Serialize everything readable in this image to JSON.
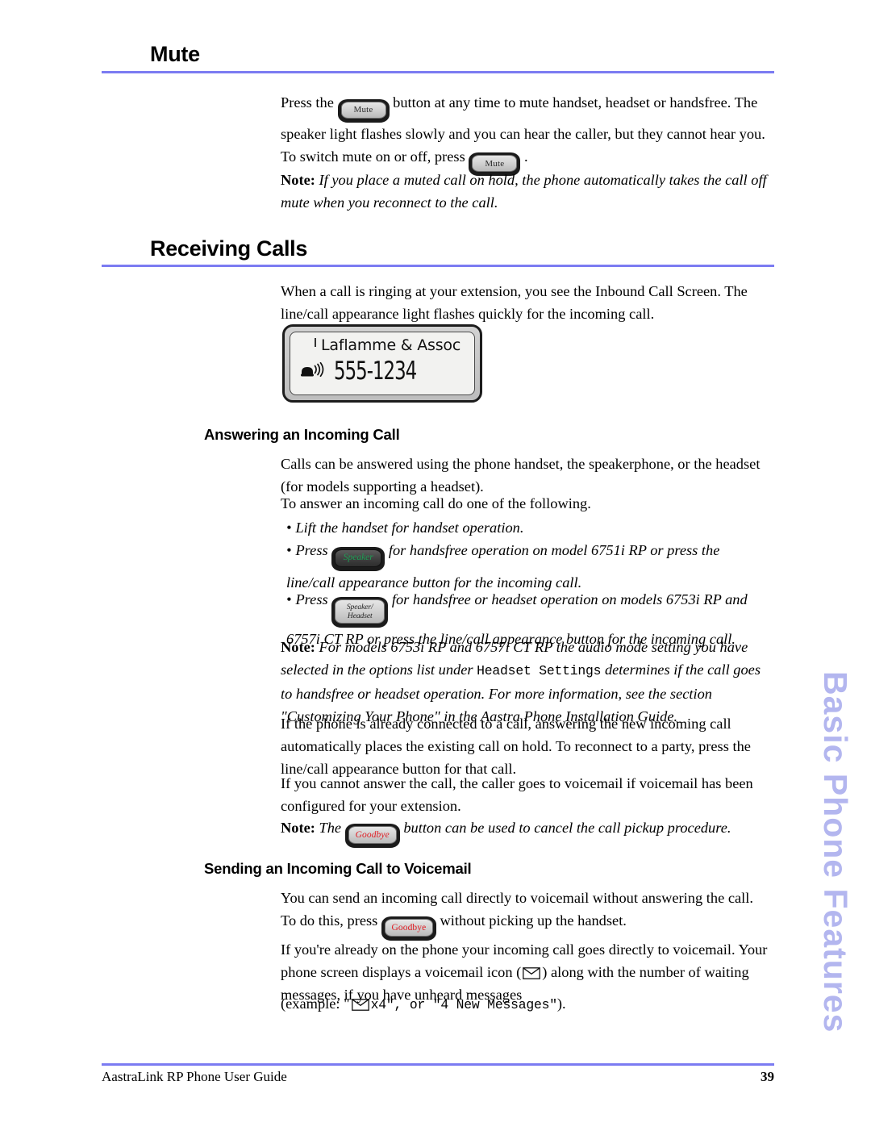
{
  "document": {
    "footer_title": "AastraLink RP Phone User Guide",
    "page_number": "39",
    "side_tab": "Basic Phone Features",
    "rule_color": "#7b7bf2",
    "side_tab_color": "#b3b6ef"
  },
  "sections": {
    "mute": {
      "heading": "Mute",
      "p1_a": "Press the",
      "p1_b": "button at any time to mute handset, headset or handsfree. The speaker light flashes slowly and you can hear the caller, but they cannot hear you. To switch mute on or off, press",
      "p1_c": ".",
      "note_label": "Note:",
      "note_text": "If you place a muted call on hold, the phone automatically takes the call off mute when you reconnect to the call."
    },
    "receiving_calls": {
      "heading": "Receiving Calls",
      "p1": "When a call is ringing at your extension, you see the Inbound Call Screen. The line/call appearance light flashes quickly for the incoming call.",
      "lcd_screen": {
        "caller_name": "Laflamme & Assoc",
        "caller_number": "555-1234",
        "ring_icon": "ringing-phone-icon"
      }
    },
    "answering": {
      "heading": "Answering an Incoming Call",
      "p1": "Calls can be answered using the phone handset, the speakerphone, or the headset (for models supporting a headset).",
      "p2": "To answer an incoming call do one of the following.",
      "bullets": [
        {
          "text_before": "Lift the handset for handset operation.",
          "button": null,
          "text_after": ""
        },
        {
          "text_before": "Press",
          "button": "Speaker",
          "text_after": "for handsfree operation on model 6751i RP or press the line/call appearance button for the incoming call."
        },
        {
          "text_before": "Press",
          "button": "Speaker/ Headset",
          "text_after": "for handsfree or headset operation on models 6753i RP and 6757i CT RP or press the line/call appearance button for the incoming call."
        }
      ],
      "note_label": "Note:",
      "note_a": "For models 6753i RP and 6757i CT RP the audio mode setting you have selected in the options list under",
      "note_mono": "Headset Settings",
      "note_b": "determines if the call goes to handsfree or headset operation. For more information, see the section \"Customizing Your Phone\" in the Aastra Phone Installation Guide.",
      "p3": "If the phone is already connected to a call, answering the new incoming call automatically places the existing call on hold. To reconnect to a party, press the line/call appearance button for that call.",
      "p4": "If you cannot answer the call, the caller goes to voicemail if voicemail has been configured for your extension.",
      "note2_label": "Note:",
      "note2_a": "The",
      "note2_button": "Goodbye",
      "note2_b": "button can be used to cancel the call pickup procedure."
    },
    "voicemail": {
      "heading": "Sending an Incoming Call to Voicemail",
      "p1_a": "You can send an incoming call directly to voicemail without answering the call. To do this, press",
      "p1_button": "Goodbye",
      "p1_b": "without picking up the handset.",
      "p2_a": "If you're already on the phone your incoming call goes directly to voicemail. Your phone screen displays a voicemail icon (",
      "p2_b": ") along with the number of waiting messages, if you have unheard messages",
      "p3_a": "(example: \"",
      "p3_mono1": "x4\", or \"4 New Messages\"",
      "p3_b": ")."
    }
  },
  "buttons": {
    "mute": "Mute",
    "speaker": "Speaker",
    "speaker_headset_line1": "Speaker/",
    "speaker_headset_line2": "Headset",
    "goodbye": "Goodbye",
    "speaker_label_color": "#1f9d55",
    "goodbye_label_color": "#e01b22"
  }
}
